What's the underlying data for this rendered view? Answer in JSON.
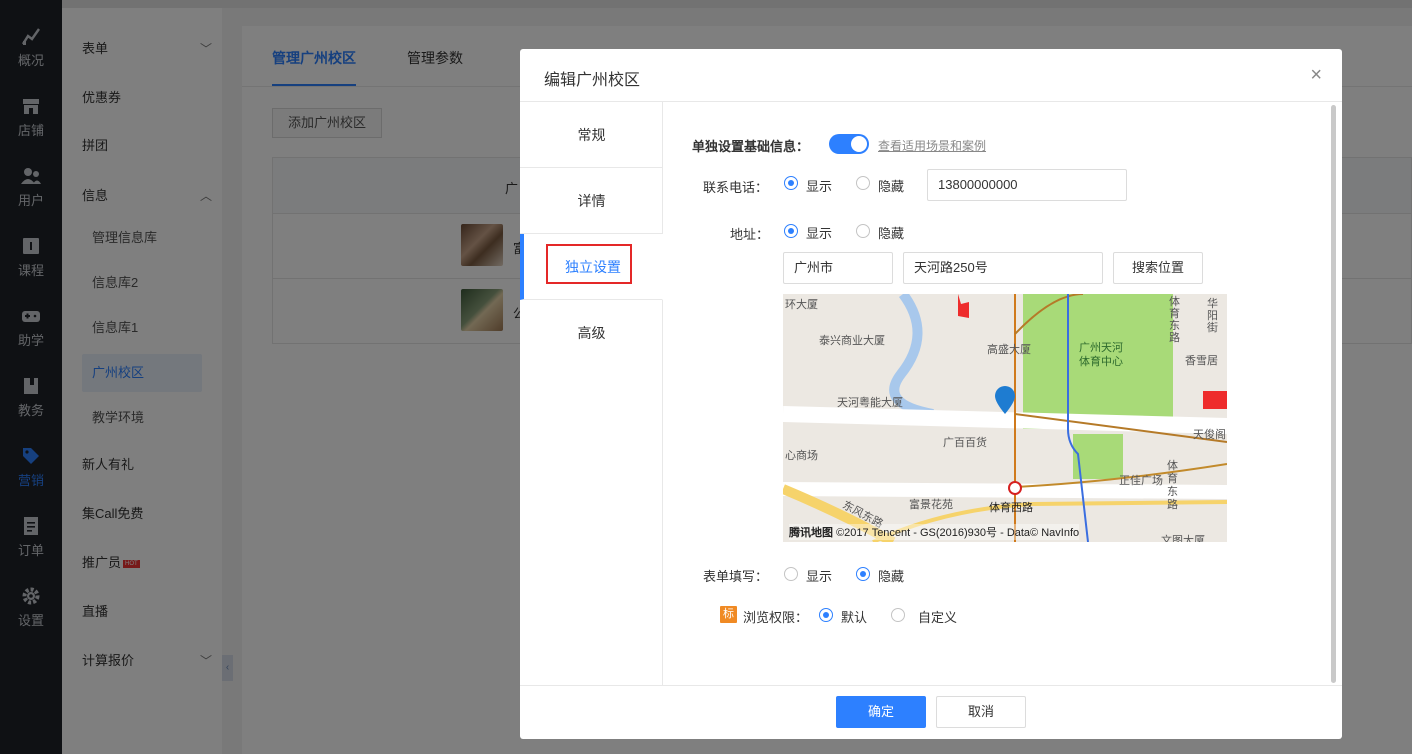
{
  "rail": {
    "items": [
      {
        "label": "概况",
        "icon": "chart-icon"
      },
      {
        "label": "店铺",
        "icon": "store-icon"
      },
      {
        "label": "用户",
        "icon": "users-icon"
      },
      {
        "label": "课程",
        "icon": "course-icon"
      },
      {
        "label": "助学",
        "icon": "gamepad-icon"
      },
      {
        "label": "教务",
        "icon": "book-icon"
      },
      {
        "label": "营销",
        "icon": "tag-icon"
      },
      {
        "label": "订单",
        "icon": "order-icon"
      },
      {
        "label": "设置",
        "icon": "gear-icon"
      }
    ],
    "active_index": 6
  },
  "sidebar": {
    "items": [
      {
        "label": "表单",
        "chevron": "﹀"
      },
      {
        "label": "优惠券"
      },
      {
        "label": "拼团"
      },
      {
        "label": "信息",
        "chevron": "︿"
      },
      {
        "label": "管理信息库"
      },
      {
        "label": "信息库2"
      },
      {
        "label": "信息库1"
      },
      {
        "label": "广州校区"
      },
      {
        "label": "教学环境"
      },
      {
        "label": "新人有礼"
      },
      {
        "label": "集Call免费"
      },
      {
        "label": "推广员",
        "badge": "HOT"
      },
      {
        "label": "直播"
      },
      {
        "label": "计算报价",
        "chevron": "﹀"
      }
    ],
    "collapse_glyph": "‹"
  },
  "main": {
    "tabs": [
      "管理广州校区",
      "管理参数"
    ],
    "add_button": "添加广州校区",
    "table_head_fragment": "广",
    "row_fragments": [
      "富",
      "公"
    ]
  },
  "modal": {
    "title": "编辑广州校区",
    "close": "×",
    "nav": [
      "常规",
      "详情",
      "独立设置",
      "高级"
    ],
    "active_nav": 2,
    "basic_info": {
      "label": "单独设置基础信息：",
      "enabled": true,
      "link": "查看适用场景和案例"
    },
    "phone": {
      "label": "联系电话：",
      "options": [
        "显示",
        "隐藏"
      ],
      "selected": 0,
      "value": "13800000000"
    },
    "address": {
      "label": "地址：",
      "options": [
        "显示",
        "隐藏"
      ],
      "selected": 0,
      "city": "广州市",
      "street": "天河路250号",
      "search_button": "搜索位置"
    },
    "map": {
      "labels": [
        "环大厦",
        "泰兴商业大厦",
        "高盛大厦",
        "广州天河",
        "体育中心",
        "天河粤能大厦",
        "广百百货",
        "心商场",
        "富景花苑",
        "体育西路",
        "天俊阁",
        "正佳广场",
        "体育东路",
        "香雪居",
        "体育东路",
        "华阳街",
        "东风东路",
        "文图大厦"
      ],
      "logo": "腾讯地图",
      "copyright": "©2017 Tencent - GS(2016)930号 - Data© NavInfo"
    },
    "form_fill": {
      "label": "表单填写：",
      "options": [
        "显示",
        "隐藏"
      ],
      "selected": 1
    },
    "browse": {
      "tag": "标",
      "label": "浏览权限：",
      "options": [
        "默认",
        "自定义"
      ],
      "selected": 0
    },
    "confirm": "确定",
    "cancel": "取消"
  }
}
